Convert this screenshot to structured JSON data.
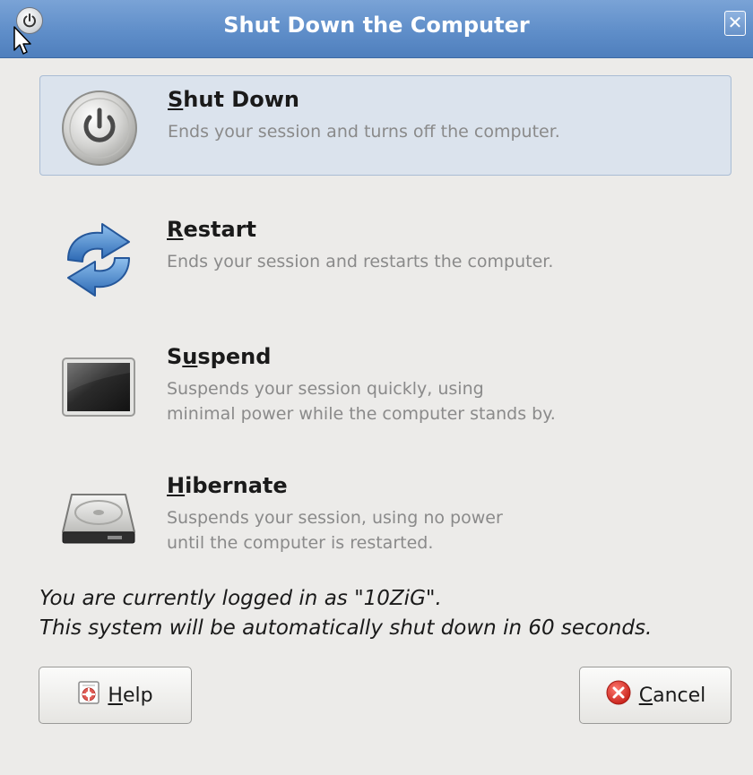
{
  "window": {
    "title": "Shut Down the Computer",
    "close_glyph": "✕"
  },
  "options": [
    {
      "key": "S",
      "label_rest": "hut Down",
      "label_prefix": "",
      "description": "Ends your session and turns off the computer.",
      "icon": "power-icon",
      "selected": true
    },
    {
      "key": "R",
      "label_prefix": "",
      "label_rest": "estart",
      "description": "Ends your session and restarts the computer.",
      "icon": "restart-icon",
      "selected": false
    },
    {
      "key": "u",
      "label_prefix": "S",
      "label_rest": "spend",
      "description_line1": "Suspends your session quickly, using",
      "description_line2": "minimal power while the computer stands by.",
      "icon": "monitor-icon",
      "selected": false
    },
    {
      "key": "H",
      "label_prefix": "",
      "label_rest": "ibernate",
      "description_line1": "Suspends your session, using no power",
      "description_line2": "until the computer is restarted.",
      "icon": "hard-drive-icon",
      "selected": false
    }
  ],
  "status": {
    "logged_in": "You are currently logged in as \"10ZiG\".",
    "countdown": "This system will be automatically shut down in 60 seconds."
  },
  "buttons": {
    "help_key": "H",
    "help_rest": "elp",
    "cancel_key": "C",
    "cancel_rest": "ancel"
  },
  "colors": {
    "titlebar": "#5f8ec9",
    "selected_row": "#dbe3ed",
    "description_text": "#8a8a8a",
    "cancel_icon": "#d9342b",
    "restart_arrows": "#3f7fc7"
  }
}
